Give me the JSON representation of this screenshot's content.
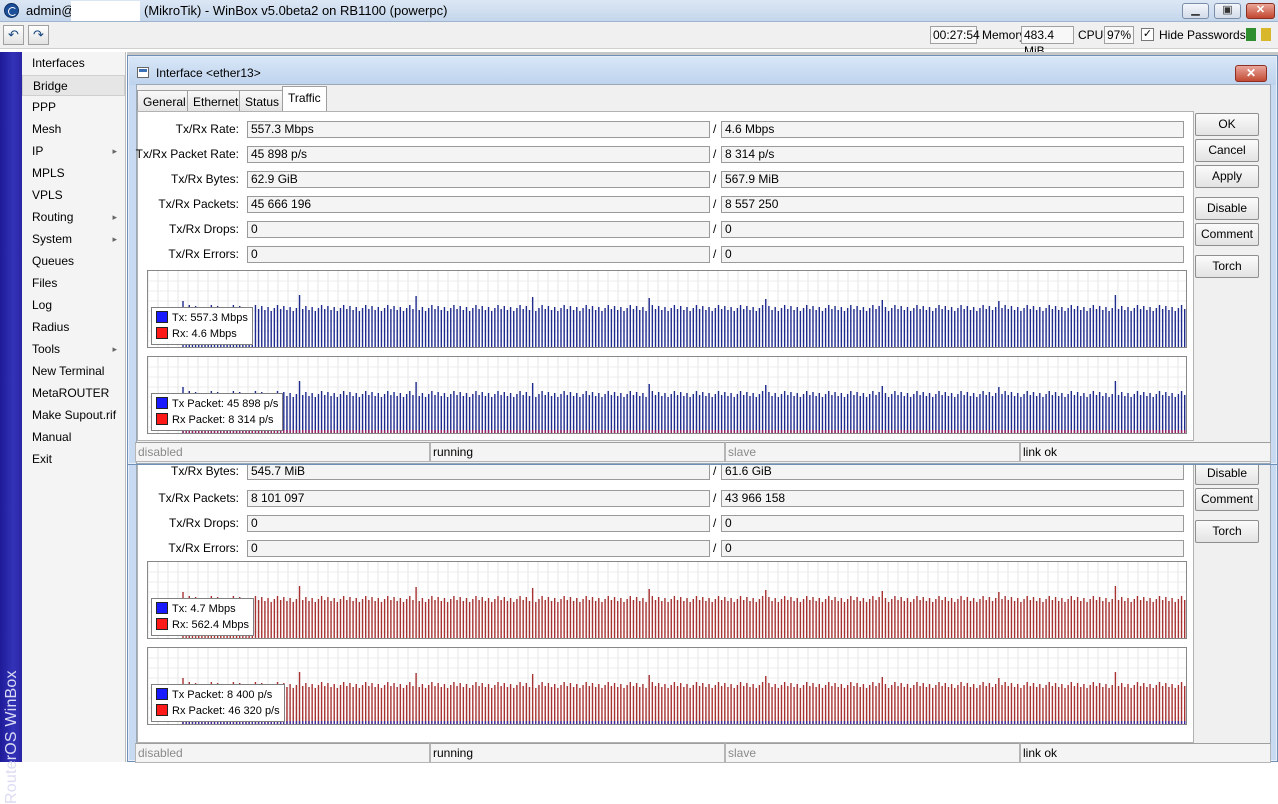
{
  "app": {
    "title_user": "admin@",
    "title_text": "(MikroTik) - WinBox v5.0beta2 on RB1100 (powerpc)",
    "minimize_label": "▁",
    "maximize_label": "▣",
    "close_label": "✕",
    "brand": "RouterOS WinBox"
  },
  "toolbar": {
    "undo_label": "↶",
    "redo_label": "↷",
    "time": "00:27:54",
    "memory_label": "Memory:",
    "memory": "483.4 MiB",
    "cpu_label": "CPU:",
    "cpu": "97%",
    "hide_passwords_label": "Hide Passwords",
    "hide_passwords_checked": "✓",
    "indicator_colors": [
      "#2f8f2f",
      "#d8b72b"
    ]
  },
  "sidebar": {
    "items": [
      {
        "label": "Interfaces",
        "arrow": ""
      },
      {
        "label": "Bridge",
        "arrow": ""
      },
      {
        "label": "PPP",
        "arrow": ""
      },
      {
        "label": "Mesh",
        "arrow": ""
      },
      {
        "label": "IP",
        "arrow": "▸"
      },
      {
        "label": "MPLS",
        "arrow": ""
      },
      {
        "label": "VPLS",
        "arrow": ""
      },
      {
        "label": "Routing",
        "arrow": "▸"
      },
      {
        "label": "System",
        "arrow": "▸"
      },
      {
        "label": "Queues",
        "arrow": ""
      },
      {
        "label": "Files",
        "arrow": ""
      },
      {
        "label": "Log",
        "arrow": ""
      },
      {
        "label": "Radius",
        "arrow": ""
      },
      {
        "label": "Tools",
        "arrow": "▸"
      },
      {
        "label": "New Terminal",
        "arrow": ""
      },
      {
        "label": "MetaROUTER",
        "arrow": ""
      },
      {
        "label": "Make Supout.rif",
        "arrow": ""
      },
      {
        "label": "Manual",
        "arrow": ""
      },
      {
        "label": "Exit",
        "arrow": ""
      }
    ]
  },
  "top_window": {
    "title": "Interface <ether13>",
    "close_label": "✕",
    "tabs": [
      "General",
      "Ethernet",
      "Status",
      "Traffic"
    ],
    "fields": [
      {
        "label": "Tx/Rx Rate:",
        "tx": "557.3 Mbps",
        "rx": "4.6 Mbps"
      },
      {
        "label": "Tx/Rx Packet Rate:",
        "tx": "45 898 p/s",
        "rx": "8 314 p/s"
      },
      {
        "label": "Tx/Rx Bytes:",
        "tx": "62.9 GiB",
        "rx": "567.9 MiB"
      },
      {
        "label": "Tx/Rx Packets:",
        "tx": "45 666 196",
        "rx": "8 557 250"
      },
      {
        "label": "Tx/Rx Drops:",
        "tx": "0",
        "rx": "0"
      },
      {
        "label": "Tx/Rx Errors:",
        "tx": "0",
        "rx": "0"
      }
    ],
    "legend_rate": [
      {
        "label": "Tx:  557.3 Mbps",
        "color": "#1a1aff"
      },
      {
        "label": "Rx:  4.6 Mbps",
        "color": "#ff1a1a"
      }
    ],
    "legend_packet": [
      {
        "label": "Tx Packet:  45 898 p/s",
        "color": "#1a1aff"
      },
      {
        "label": "Rx Packet:  8 314 p/s",
        "color": "#ff1a1a"
      }
    ],
    "buttons": [
      "OK",
      "Cancel",
      "Apply",
      "Disable",
      "Comment",
      "Torch"
    ],
    "status": [
      "disabled",
      "running",
      "slave",
      "link ok"
    ]
  },
  "bottom_window": {
    "partial_row": {
      "label": "Tx/Rx Bytes:",
      "tx": "545.7 MiB",
      "rx": "61.6 GiB"
    },
    "fields": [
      {
        "label": "Tx/Rx Packets:",
        "tx": "8 101 097",
        "rx": "43 966 158"
      },
      {
        "label": "Tx/Rx Drops:",
        "tx": "0",
        "rx": "0"
      },
      {
        "label": "Tx/Rx Errors:",
        "tx": "0",
        "rx": "0"
      }
    ],
    "legend_rate": [
      {
        "label": "Tx:  4.7 Mbps",
        "color": "#1a1aff"
      },
      {
        "label": "Rx:  562.4 Mbps",
        "color": "#ff1a1a"
      }
    ],
    "legend_packet": [
      {
        "label": "Tx Packet:  8 400 p/s",
        "color": "#1a1aff"
      },
      {
        "label": "Rx Packet:  46 320 p/s",
        "color": "#ff1a1a"
      }
    ],
    "buttons": [
      "Disable",
      "Comment",
      "Torch"
    ],
    "status": [
      "disabled",
      "running",
      "slave",
      "link ok"
    ]
  }
}
